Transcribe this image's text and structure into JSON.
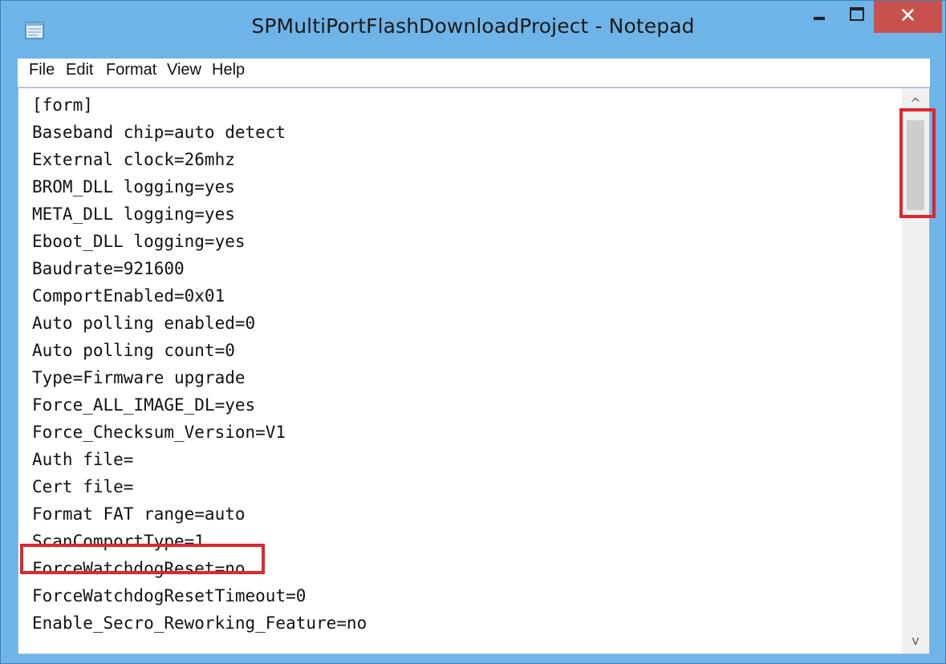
{
  "window": {
    "title": "SPMultiPortFlashDownloadProject - Notepad",
    "close_glyph": "✕",
    "app_icon": "notepad-icon"
  },
  "menu": [
    "File",
    "Edit",
    "Format",
    "View",
    "Help"
  ],
  "editor": {
    "lines": [
      "[form]",
      "Baseband chip=auto detect",
      "External clock=26mhz",
      "BROM_DLL logging=yes",
      "META_DLL logging=yes",
      "Eboot_DLL logging=yes",
      "Baudrate=921600",
      "ComportEnabled=0x01",
      "Auto polling enabled=0",
      "Auto polling count=0",
      "Type=Firmware upgrade",
      "Force_ALL_IMAGE_DL=yes",
      "Force_Checksum_Version=V1",
      "Auth file=",
      "Cert file=",
      "Format FAT range=auto",
      "ScanComportType=1",
      "ForceWatchdogReset=no",
      "ForceWatchdogResetTimeout=0",
      "Enable_Secro_Reworking_Feature=no"
    ]
  },
  "scrollbar": {
    "up_glyph": "^",
    "down_glyph": "v"
  },
  "colors": {
    "titlebar": "#6fb4e8",
    "close": "#c7514c",
    "highlight": "#e0262e"
  }
}
